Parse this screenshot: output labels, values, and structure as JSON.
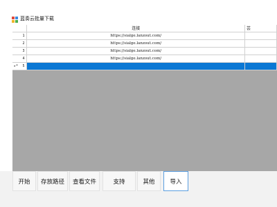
{
  "window": {
    "title": "蓝奏云批量下载"
  },
  "grid": {
    "columns": [
      "连接",
      "芸"
    ],
    "rows": [
      {
        "index": "1",
        "url": "https://sialge.lanzout.com/",
        "extra": ""
      },
      {
        "index": "2",
        "url": "https://sialge.lanzout.com/",
        "extra": ""
      },
      {
        "index": "3",
        "url": "https://sialge.lanzout.com/",
        "extra": ""
      },
      {
        "index": "4",
        "url": "https://sialge.lanzout.com/",
        "extra": ""
      },
      {
        "index": "5",
        "url": "",
        "extra": "",
        "selected": true
      }
    ]
  },
  "toolbar": {
    "start_label": "开始",
    "save_path_label": "存放路径",
    "view_files_label": "查看文件",
    "support_label": "支持",
    "other_label": "其他",
    "import_label": "导入"
  },
  "colors": {
    "selection": "#0b78d4",
    "grid_background": "#a7a7a7",
    "toolbar_background": "#f2f2f2"
  }
}
